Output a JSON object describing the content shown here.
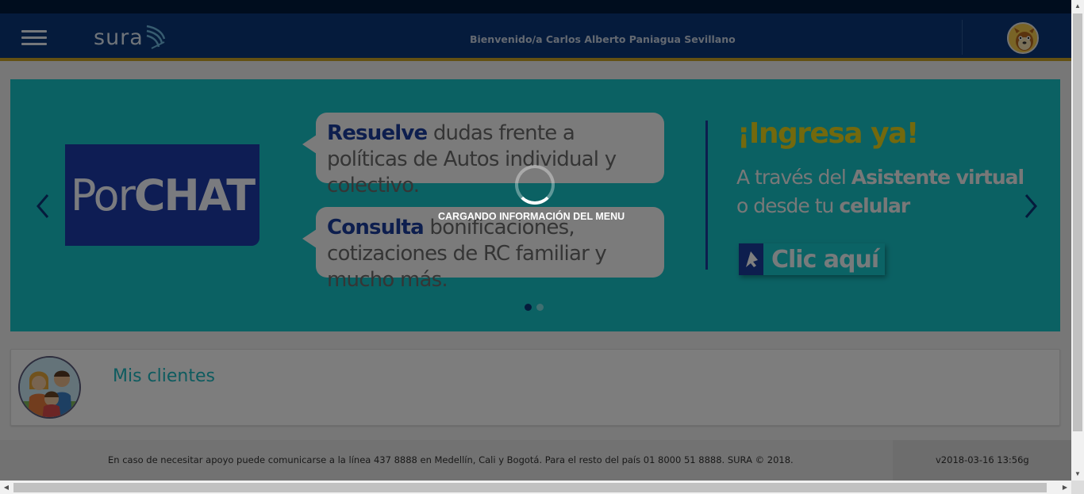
{
  "header": {
    "logo_text": "sura",
    "welcome": "Bienvenido/a Carlos Alberto Paniagua Sevillano",
    "menu_icon": "hamburger-icon",
    "avatar_icon": "user-avatar-icon"
  },
  "banner": {
    "porchat_pre": "Por",
    "porchat_bold": "CHAT",
    "bubble1_bold": "Resuelve",
    "bubble1_rest": " dudas frente a políticas de Autos individual y colectivo.",
    "bubble2_bold": "Consulta",
    "bubble2_rest": " bonificaciones, cotizaciones de RC familiar y mucho más.",
    "cta_title": "¡Ingresa ya!",
    "cta_line1_pre": "A través del ",
    "cta_line1_bold": "Asistente virtual",
    "cta_line2_pre": "o desde tu ",
    "cta_line2_bold": "celular",
    "cta_button": "Clic aquí",
    "slide_count": 2,
    "active_slide": 1,
    "colors": {
      "background": "#17c2c7",
      "brand_blue": "#1b3c9c",
      "title_yellow": "#e6d31b"
    }
  },
  "clients_card": {
    "title": "Mis clientes",
    "icon": "family-avatar-icon"
  },
  "footer": {
    "support_text": "En caso de necesitar apoyo puede comunicarse a la línea 437 8888 en Medellín, Cali y Bogotá. Para el resto del país 01 8000 51 8888. SURA © 2018.",
    "version": "v2018-03-16 13:56g"
  },
  "overlay": {
    "loading_text": "CARGANDO INFORMACIÓN DEL MENU",
    "spinner_icon": "loading-spinner-icon"
  }
}
